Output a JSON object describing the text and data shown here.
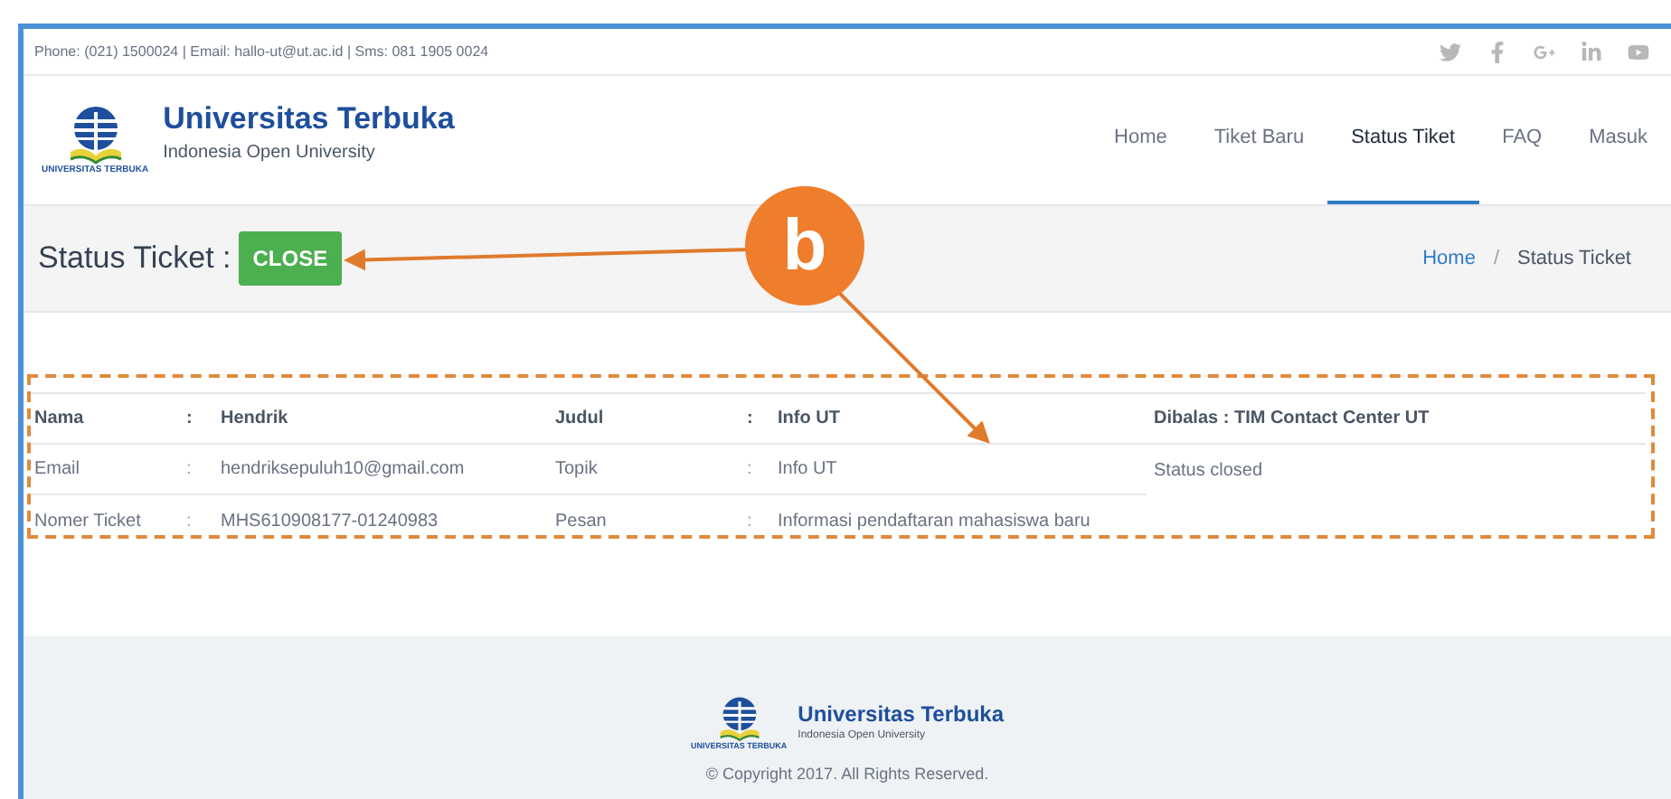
{
  "top_bar": {
    "contact": "Phone: (021) 1500024 | Email: hallo-ut@ut.ac.id | Sms: 081 1905 0024",
    "social": [
      {
        "kind": "twitter"
      },
      {
        "kind": "facebook"
      },
      {
        "kind": "google-plus"
      },
      {
        "kind": "linkedin"
      },
      {
        "kind": "youtube"
      }
    ]
  },
  "brand": {
    "logo_caption": "UNIVERSITAS TERBUKA",
    "name": "Universitas Terbuka",
    "tagline": "Indonesia Open University"
  },
  "nav": [
    {
      "label": "Home",
      "selected": false
    },
    {
      "label": "Tiket Baru",
      "selected": false
    },
    {
      "label": "Status Tiket",
      "selected": true
    },
    {
      "label": "FAQ",
      "selected": false
    },
    {
      "label": "Masuk",
      "selected": false
    }
  ],
  "title_bar": {
    "label": "Status Ticket :",
    "status": "CLOSE",
    "breadcrumb": [
      {
        "label": "Home",
        "kind": "link"
      },
      {
        "label": "Status Ticket",
        "kind": "current"
      }
    ],
    "separator": "/"
  },
  "table": {
    "rows": [
      {
        "kind": "heading",
        "cells": [
          "Nama",
          ":",
          "Hendrik",
          "Judul",
          ":",
          "Info UT",
          "Dibalas : TIM Contact Center UT"
        ]
      },
      {
        "kind": "data",
        "cells": [
          "Email",
          ":",
          "hendriksepuluh10@gmail.com",
          "Topik",
          ":",
          "Info UT",
          "Status closed"
        ]
      },
      {
        "kind": "data",
        "cells": [
          "Nomer Ticket",
          ":",
          "MHS610908177-01240983",
          "Pesan",
          ":",
          "Informasi pendaftaran mahasiswa baru",
          ""
        ]
      }
    ]
  },
  "annotation": {
    "letter": "b"
  },
  "footer": {
    "logo_caption": "UNIVERSITAS TERBUKA",
    "name": "Universitas Terbuka",
    "tagline": "Indonesia Open University",
    "copyright": "© Copyright 2017. All Rights Reserved."
  }
}
